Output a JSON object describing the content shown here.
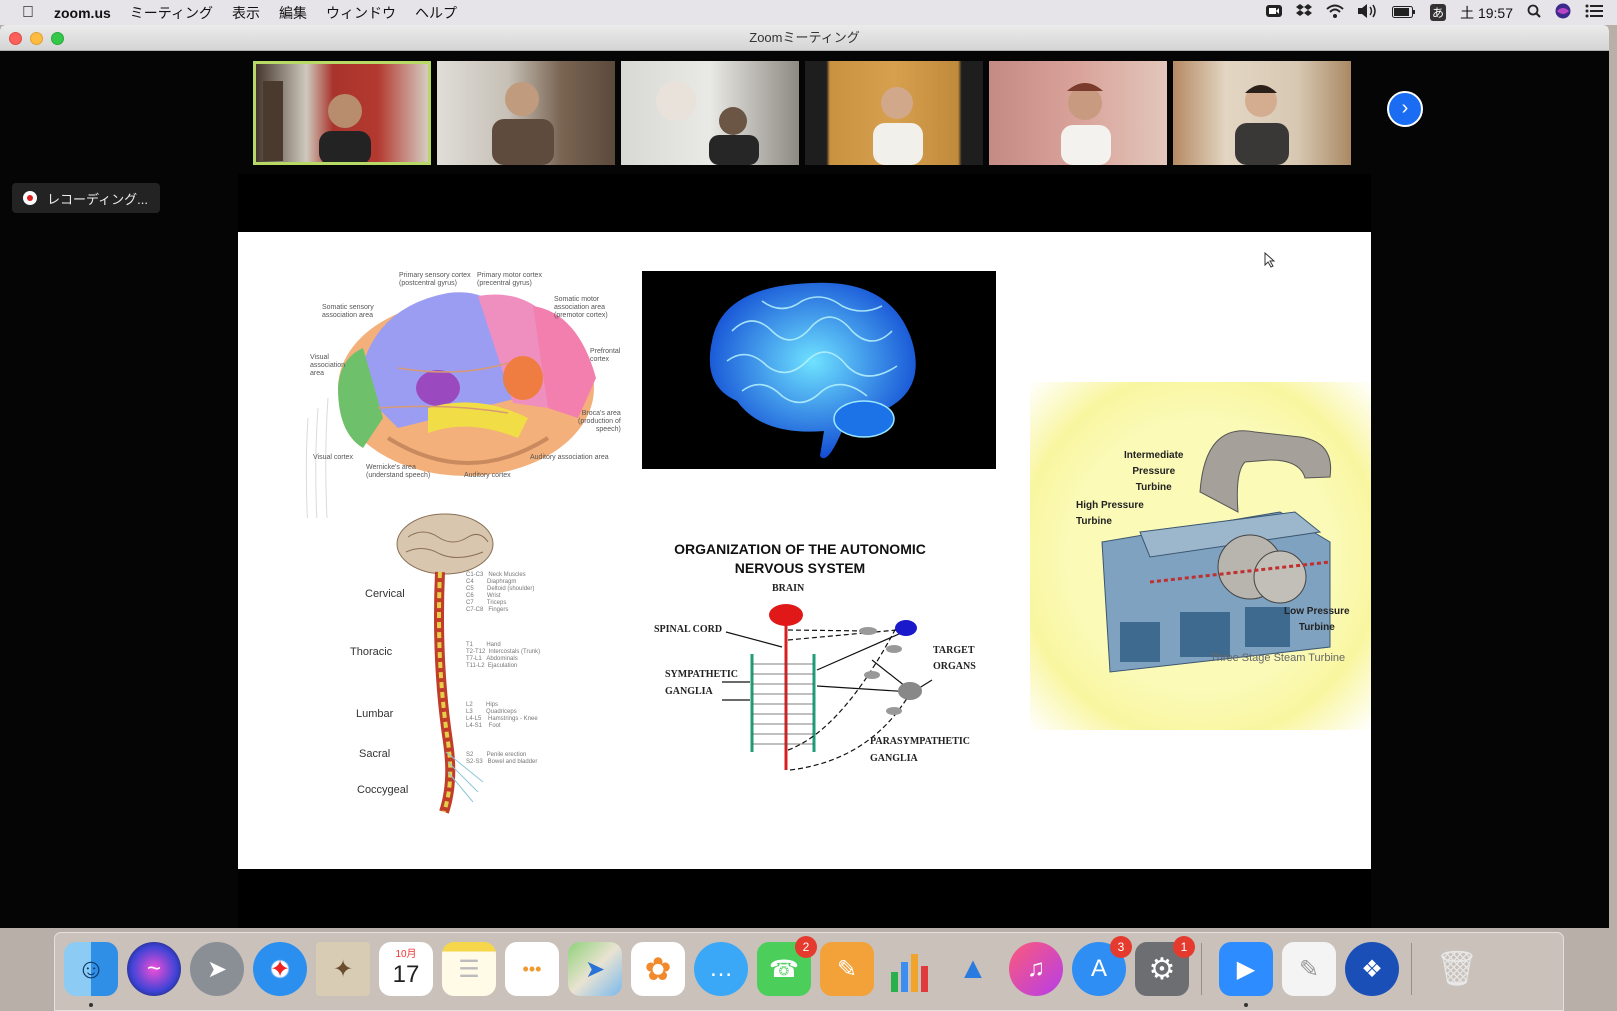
{
  "menubar": {
    "app": "zoom.us",
    "items": [
      "ミーティング",
      "表示",
      "編集",
      "ウィンドウ",
      "ヘルプ"
    ],
    "input_indicator": "あ",
    "clock": "土 19:57"
  },
  "window": {
    "title": "Zoomミーティング"
  },
  "recording": {
    "label": "レコーディング..."
  },
  "slide": {
    "brain_diagram": {
      "labels": {
        "primary_sensory": "Primary sensory cortex\n(postcentral gyrus)",
        "primary_motor": "Primary motor cortex\n(precentral gyrus)",
        "somatic_sensory": "Somatic sensory\nassociation area",
        "somatic_motor": "Somatic motor\nassociation area\n(premotor cortex)",
        "visual_association": "Visual\nassociation\narea",
        "prefrontal": "Prefrontal\ncortex",
        "brocas": "Broca's area\n(production of\nspeech)",
        "visual_cortex": "Visual cortex",
        "wernickes": "Wernicke's area\n(understand speech)",
        "auditory_cortex": "Auditory cortex",
        "auditory_association": "Auditory association area"
      }
    },
    "spine": {
      "regions": [
        "Cervical",
        "Thoracic",
        "Lumbar",
        "Sacral",
        "Coccygeal"
      ],
      "levels": {
        "cervical": "C1-C3   Neck Muscles\nC4        Diaphragm\nC5        Deltoid (shoulder)\nC6        Wrist\nC7        Triceps\nC7-C8   Fingers",
        "thoracic": "T1        Hand\nT2-T12  Intercostals (Trunk)\nT7-L1   Abdominals\nT11-L2  Ejaculation",
        "lumbar": "L2        Hips\nL3        Quadriceps\nL4-L5    Hamstrings - Knee\nL4-S1    Foot",
        "sacral": "S2        Penile erection\nS2-S3   Bowel and bladder"
      }
    },
    "ans": {
      "title": "ORGANIZATION OF THE AUTONOMIC NERVOUS SYSTEM",
      "labels": {
        "brain": "BRAIN",
        "spinal_cord": "SPINAL CORD",
        "sympathetic": "SYMPATHETIC\nGANGLIA",
        "target": "TARGET\nORGANS",
        "parasympathetic": "PARASYMPATHETIC\nGANGLIA"
      }
    },
    "turbine": {
      "labels": {
        "intermediate": "Intermediate\nPressure\nTurbine",
        "high": "High Pressure\nTurbine",
        "low": "Low Pressure\nTurbine",
        "caption": "Three Stage Steam Turbine"
      }
    }
  },
  "dock": {
    "calendar": {
      "month": "10月",
      "day": "17"
    },
    "badges": {
      "facetime": "2",
      "appstore": "3",
      "settings": "1"
    }
  }
}
